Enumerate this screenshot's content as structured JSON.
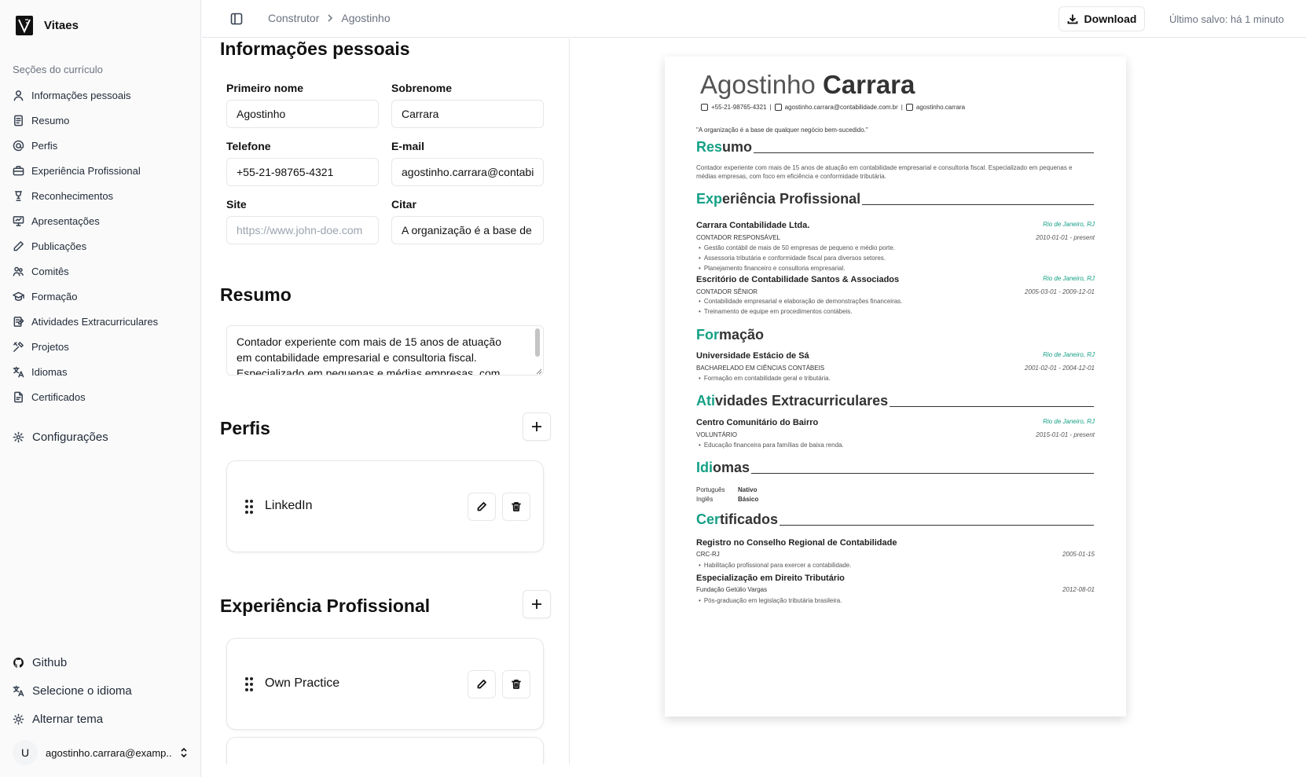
{
  "app": {
    "name": "Vitaes"
  },
  "sidebar": {
    "section_label": "Seções do currículo",
    "items": [
      {
        "label": "Informações pessoais",
        "icon": "user-icon"
      },
      {
        "label": "Resumo",
        "icon": "document-icon"
      },
      {
        "label": "Perfis",
        "icon": "at-sign-icon"
      },
      {
        "label": "Experiência Profissional",
        "icon": "briefcase-icon"
      },
      {
        "label": "Reconhecimentos",
        "icon": "award-icon"
      },
      {
        "label": "Apresentações",
        "icon": "presentation-icon"
      },
      {
        "label": "Publicações",
        "icon": "pen-icon"
      },
      {
        "label": "Comitês",
        "icon": "users-icon"
      },
      {
        "label": "Formação",
        "icon": "graduation-cap-icon"
      },
      {
        "label": "Atividades Extracurriculares",
        "icon": "clipboard-icon"
      },
      {
        "label": "Projetos",
        "icon": "tools-icon"
      },
      {
        "label": "Idiomas",
        "icon": "languages-icon"
      },
      {
        "label": "Certificados",
        "icon": "certificate-icon"
      }
    ],
    "settings_label": "Configurações",
    "bottom": {
      "github": "Github",
      "language": "Selecione o idioma",
      "theme": "Alternar tema"
    },
    "user": {
      "avatar": "U",
      "email": "agostinho.carrara@examp..."
    }
  },
  "topbar": {
    "breadcrumb": [
      "Construtor",
      "Agostinho"
    ],
    "download_label": "Download",
    "saved": "Último salvo: há 1 minuto"
  },
  "editor": {
    "personal": {
      "title": "Informações pessoais",
      "first_name_label": "Primeiro nome",
      "first_name": "Agostinho",
      "last_name_label": "Sobrenome",
      "last_name": "Carrara",
      "phone_label": "Telefone",
      "phone": "+55-21-98765-4321",
      "email_label": "E-mail",
      "email": "agostinho.carrara@contabilidade.com.br",
      "site_label": "Site",
      "site_placeholder": "https://www.john-doe.com",
      "quote_label": "Citar",
      "quote": "A organização é a base de qualquer negócio bem-sucedido."
    },
    "summary": {
      "title": "Resumo",
      "text": "Contador experiente com mais de 15 anos de atuação em contabilidade empresarial e consultoria fiscal. Especializado em pequenas e médias empresas, com foco em eficiência e conformidade tributária."
    },
    "profiles": {
      "title": "Perfis",
      "items": [
        "LinkedIn"
      ]
    },
    "experience": {
      "title": "Experiência Profissional",
      "items": [
        "Own Practice"
      ]
    }
  },
  "resume": {
    "first_name": "Agostinho",
    "last_name": "Carrara",
    "phone": "+55-21-98765-4321",
    "email": "agostinho.carrara@contabilidade.com.br",
    "handle": "agostinho.carrara",
    "quote": "\"A organização é a base de qualquer negócio bem-sucedido.\"",
    "accent_color": "#14a085",
    "summary": {
      "accent": "Res",
      "rest": "umo",
      "text": "Contador experiente com mais de 15 anos de atuação em contabilidade empresarial e consultoria fiscal. Especializado em pequenas e médias empresas, com foco em eficiência e conformidade tributária."
    },
    "experience": {
      "accent": "Exp",
      "rest": "eriência Profissional",
      "entries": [
        {
          "org": "Carrara Contabilidade Ltda.",
          "location": "Rio de Janeiro, RJ",
          "role": "CONTADOR RESPONSÁVEL",
          "dates": "2010-01-01 - present",
          "bullets": [
            "Gestão contábil de mais de 50 empresas de pequeno e médio porte.",
            "Assessoria tributária e conformidade fiscal para diversos setores.",
            "Planejamento financeiro e consultoria empresarial."
          ]
        },
        {
          "org": "Escritório de Contabilidade Santos & Associados",
          "location": "Rio de Janeiro, RJ",
          "role": "CONTADOR SÊNIOR",
          "dates": "2005-03-01 - 2009-12-01",
          "bullets": [
            "Contabilidade empresarial e elaboração de demonstrações financeiras.",
            "Treinamento de equipe em procedimentos contábeis."
          ]
        }
      ]
    },
    "education": {
      "accent": "For",
      "rest": "mação",
      "org": "Universidade Estácio de Sá",
      "location": "Rio de Janeiro, RJ",
      "role": "BACHARELADO EM CIÊNCIAS CONTÁBEIS",
      "dates": "2001-02-01 - 2004-12-01",
      "bullet": "Formação em contabilidade geral e tributária."
    },
    "extracurricular": {
      "accent": "Ati",
      "rest": "vidades Extracurriculares",
      "org": "Centro Comunitário do Bairro",
      "location": "Rio de Janeiro, RJ",
      "role": "VOLUNTÁRIO",
      "dates": "2015-01-01 - present",
      "bullet": "Educação financeira para famílias de baixa renda."
    },
    "languages": {
      "accent": "Idi",
      "rest": "omas",
      "items": [
        {
          "name": "Português",
          "level": "Nativo"
        },
        {
          "name": "Inglês",
          "level": "Básico"
        }
      ]
    },
    "certificates": {
      "accent": "Cer",
      "rest": "tificados",
      "items": [
        {
          "name": "Registro no Conselho Regional de Contabilidade",
          "issuer": "CRC-RJ",
          "date": "2005-01-15",
          "bullet": "Habilitação profissional para exercer a contabilidade."
        },
        {
          "name": "Especialização em Direito Tributário",
          "issuer": "Fundação Getúlio Vargas",
          "date": "2012-08-01",
          "bullet": "Pós-graduação em legislação tributária brasileira."
        }
      ]
    }
  }
}
